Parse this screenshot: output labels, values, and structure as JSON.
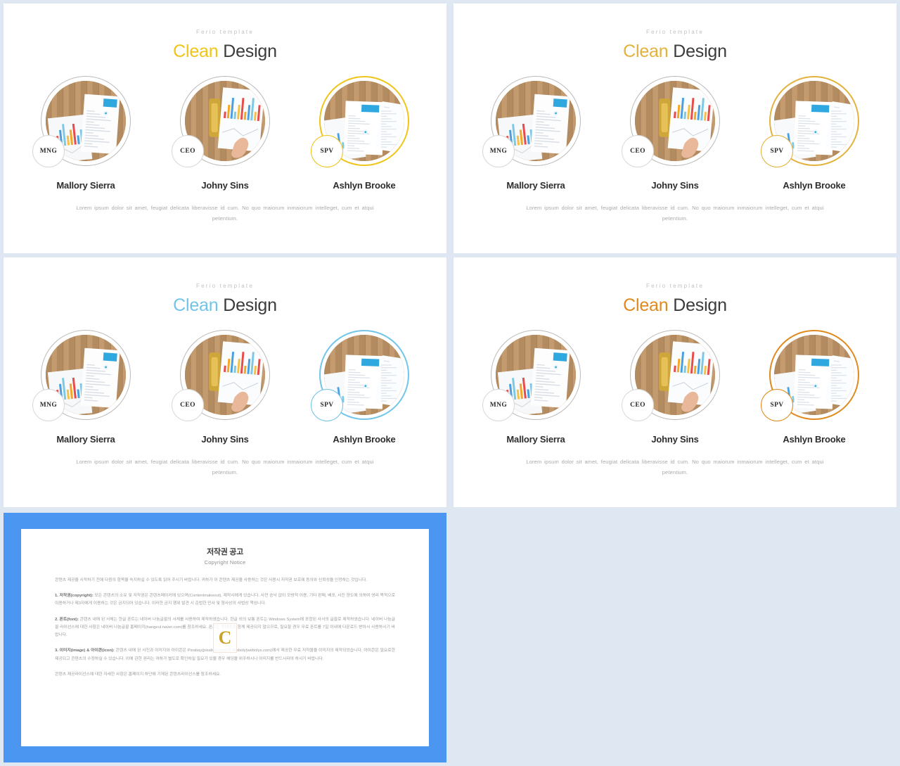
{
  "colors": {
    "page_background": "#dfe7f2",
    "slide_background": "#ffffff",
    "copyright_frame": "#4a96f0",
    "accent_yellow": "#f0c419",
    "accent_gold": "#e3b23c",
    "accent_skyblue": "#72c4e8",
    "accent_orange": "#e08a1e",
    "ring_grey": "#b9b9b9",
    "name_text": "#2d2d2d",
    "caption_text": "#a9a9a9",
    "watermark_gold": "#c9a227"
  },
  "slides": [
    {
      "id": "slide-1",
      "eyebrow": "Ferio template",
      "headline_accent": "Clean",
      "headline_rest": " Design",
      "accent_color": "#f0c419",
      "highlight_index": 2,
      "members": [
        {
          "badge": "MNG",
          "name": "Mallory Sierra",
          "photo": "office-desk-charts"
        },
        {
          "badge": "CEO",
          "name": "Johny Sins",
          "photo": "hand-pointing-chart"
        },
        {
          "badge": "SPV",
          "name": "Ashlyn Brooke",
          "photo": "documents-on-wood"
        }
      ],
      "caption": "Lorem ipsum dolor sit amet, feugiat delicata liberavisse id cum. No quo maiorum inmaiorum intelleget, cum et atqui petentium."
    },
    {
      "id": "slide-2",
      "eyebrow": "Ferio template",
      "headline_accent": "Clean",
      "headline_rest": " Design",
      "accent_color": "#e3b23c",
      "highlight_index": 2,
      "members": [
        {
          "badge": "MNG",
          "name": "Mallory Sierra",
          "photo": "office-desk-charts"
        },
        {
          "badge": "CEO",
          "name": "Johny Sins",
          "photo": "hand-pointing-chart"
        },
        {
          "badge": "SPV",
          "name": "Ashlyn Brooke",
          "photo": "documents-on-wood"
        }
      ],
      "caption": "Lorem ipsum dolor sit amet, feugiat delicata liberavisse id cum. No quo maiorum inmaiorum intelleget, cum et atqui petentium."
    },
    {
      "id": "slide-3",
      "eyebrow": "Ferio template",
      "headline_accent": "Clean",
      "headline_rest": " Design",
      "accent_color": "#72c4e8",
      "highlight_index": 2,
      "members": [
        {
          "badge": "MNG",
          "name": "Mallory Sierra",
          "photo": "office-desk-charts"
        },
        {
          "badge": "CEO",
          "name": "Johny Sins",
          "photo": "hand-pointing-chart"
        },
        {
          "badge": "SPV",
          "name": "Ashlyn Brooke",
          "photo": "documents-on-wood"
        }
      ],
      "caption": "Lorem ipsum dolor sit amet, feugiat delicata liberavisse id cum. No quo maiorum inmaiorum intelleget, cum et atqui petentium."
    },
    {
      "id": "slide-4",
      "eyebrow": "Ferio template",
      "headline_accent": "Clean",
      "headline_rest": " Design",
      "accent_color": "#e08a1e",
      "highlight_index": 2,
      "members": [
        {
          "badge": "MNG",
          "name": "Mallory Sierra",
          "photo": "office-desk-charts"
        },
        {
          "badge": "CEO",
          "name": "Johny Sins",
          "photo": "hand-pointing-chart"
        },
        {
          "badge": "SPV",
          "name": "Ashlyn Brooke",
          "photo": "documents-on-wood"
        }
      ],
      "caption": "Lorem ipsum dolor sit amet, feugiat delicata liberavisse id cum. No quo maiorum inmaiorum intelleget, cum et atqui petentium."
    }
  ],
  "copyright_notice": {
    "title_kr": "저작권 공고",
    "title_en": "Copyright Notice",
    "watermark": "C",
    "paragraphs": [
      {
        "lead": "",
        "text": "콘텐츠 제공을 시작하기 전에 다음의 항목을 숙지하실 수 있도록 읽어 주시기 바랍니다. 귀하가 이 콘텐츠 제공을 사용하는 것은 사용시 저작권 보호에 동의와 신뢰성을 인정하는 것입니다."
      },
      {
        "lead": "1. 저작권(copyright):",
        "text": " 모든 콘텐츠의 소유 및 저작권은 콘텐츠메이커에 있으며(Contentmakeout), 제작사에게 있습니다. 사전 승낙 없이 모방적 이용, 기타 판매, 배포, 사진 양도에 의하여 영리 목적으로 이용하거나 제3자에게 이용하는 것은 금지되어 있습니다. 이러한 금지 행위 발견 시 준법한 민사 및 형사상의 사법상 책임니다."
      },
      {
        "lead": "2. 폰트(font):",
        "text": " 콘텐츠 내에 된 서체는 한글 폰트는 네이버 나눔글꼴의 서체를 사용하여 제작하였습니다. 한글 외의 보통 폰트는 Windows System에 포함된 사서의 글꼴로 제작하였습니다. 네이버 나눔글꼴 라이선스에 대한 사항은 네이버 나눔글꼴 홈페이지(hangeul.naver.com)를 참조하세요. 폰트는 콘텐츠의 함께 제공되지 않으므로, 필요할 경우 무료 폰트를 7일 이내에 다운로드 받아서 사용하시기 바랍니다."
      },
      {
        "lead": "3. 이미지(image) & 아이콘(icon):",
        "text": " 콘텐츠 내에 된 사진과 이미지와 아이콘은 Pixabay(pixabay.com)와 Weboly(webolys.com)에서 제공한 무료 저작물을 이미지의 제작되었습니다. 아이콘은 필요로한 제공되고 콘텐츠의 수정하실 수 있습니다. 이에 관한 권리는 귀하가 별도로 확인하실 필요가 있을 경우 해당을 위주하시나 이미지를 반드시라야 하시기 바랍니다."
      },
      {
        "lead": "",
        "text": "콘텐츠 제공라이선스에 대한 자세한 사항은 홈페이지 하단에 기재된 콘텐츠라이선스를 참조하세요."
      }
    ]
  }
}
